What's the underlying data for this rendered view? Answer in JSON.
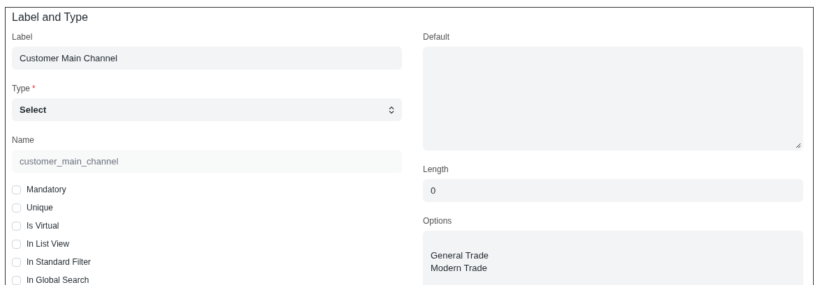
{
  "section": {
    "title": "Label and Type"
  },
  "left_fields": [
    {
      "kind": "text",
      "label": "Label",
      "value": "Customer Main Channel"
    },
    {
      "kind": "select",
      "label": "Type",
      "required_mark": "*",
      "value": "Select"
    },
    {
      "kind": "text",
      "label": "Name",
      "value": "customer_main_channel",
      "disabled": true
    }
  ],
  "checkboxes": [
    {
      "label": "Mandatory",
      "checked": false
    },
    {
      "label": "Unique",
      "checked": false
    },
    {
      "label": "Is Virtual",
      "checked": false
    },
    {
      "label": "In List View",
      "checked": false
    },
    {
      "label": "In Standard Filter",
      "checked": false
    },
    {
      "label": "In Global Search",
      "checked": false
    }
  ],
  "right_fields": [
    {
      "kind": "textarea",
      "label": "Default"
    },
    {
      "kind": "text",
      "label": "Length",
      "value": "0"
    },
    {
      "kind": "options",
      "label": "Options",
      "value": "General Trade\nModern Trade"
    }
  ]
}
